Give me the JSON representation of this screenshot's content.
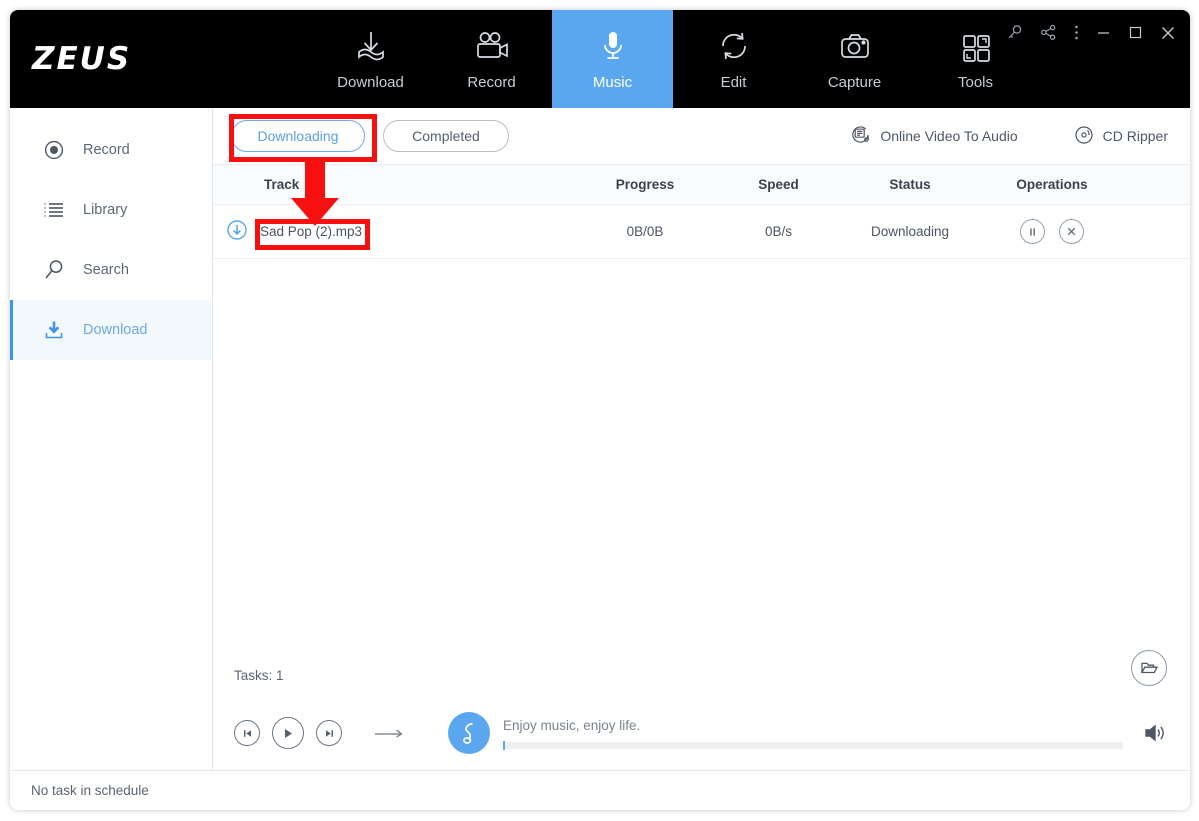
{
  "app": {
    "logo": "ZEUS",
    "accent_color": "#5ba7ef",
    "annotation_color": "#f71010"
  },
  "topnav": {
    "items": [
      {
        "label": "Download",
        "icon": "download-icon",
        "active": false
      },
      {
        "label": "Record",
        "icon": "video-camera-icon",
        "active": false
      },
      {
        "label": "Music",
        "icon": "microphone-icon",
        "active": true
      },
      {
        "label": "Edit",
        "icon": "convert-refresh-icon",
        "active": false
      },
      {
        "label": "Capture",
        "icon": "camera-icon",
        "active": false
      },
      {
        "label": "Tools",
        "icon": "grid-squares-icon",
        "active": false
      }
    ]
  },
  "window_controls": [
    {
      "name": "key-icon"
    },
    {
      "name": "share-icon"
    },
    {
      "name": "more-vertical-icon"
    },
    {
      "name": "minimize-icon"
    },
    {
      "name": "maximize-icon"
    },
    {
      "name": "close-icon"
    }
  ],
  "sidebar": {
    "items": [
      {
        "label": "Record",
        "icon": "record-circle-icon",
        "active": false
      },
      {
        "label": "Library",
        "icon": "list-icon",
        "active": false
      },
      {
        "label": "Search",
        "icon": "magnifier-icon",
        "active": false
      },
      {
        "label": "Download",
        "icon": "download-tray-icon",
        "active": true
      }
    ]
  },
  "tabs": {
    "downloading": "Downloading",
    "completed": "Completed"
  },
  "toolbar": {
    "online_video_to_audio": "Online Video To Audio",
    "cd_ripper": "CD Ripper"
  },
  "table": {
    "columns": [
      "Track",
      "Progress",
      "Speed",
      "Status",
      "Operations"
    ],
    "rows": [
      {
        "track": "Sad Pop (2).mp3",
        "progress": "0B/0B",
        "speed": "0B/s",
        "status": "Downloading",
        "state_icon": "download-arrow-circle-icon",
        "operations": [
          "pause-button",
          "cancel-button"
        ]
      }
    ]
  },
  "footer": {
    "tasks": "Tasks: 1",
    "open_folder_icon": "folder-open-icon"
  },
  "player": {
    "prev_label": "prev-track",
    "play_label": "play",
    "next_label": "next-track",
    "repeat_label": "playback-mode",
    "track_title": "Enjoy music, enjoy life.",
    "progress_percent": 0,
    "volume_label": "volume"
  },
  "statusbar": {
    "text": "No task in schedule"
  }
}
